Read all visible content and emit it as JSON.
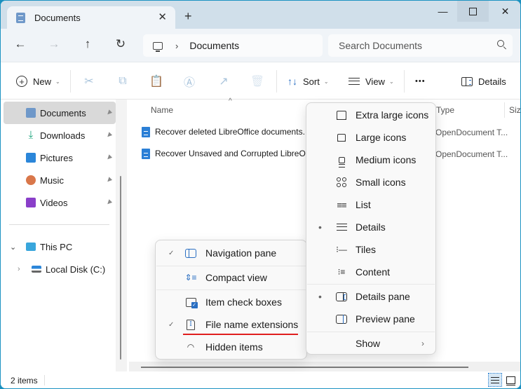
{
  "window": {
    "tab_title": "Documents",
    "tab_icon": "documents-folder-icon",
    "new_tab_glyph": "+",
    "close_tab_glyph": "✕",
    "controls": {
      "minimize": "—",
      "maximize": "maximize-icon",
      "close": "✕"
    }
  },
  "navbar": {
    "back": "←",
    "forward": "→",
    "up": "↑",
    "refresh": "↻",
    "breadcrumb_sep": "›",
    "breadcrumb": [
      "Documents"
    ],
    "search_placeholder": "Search Documents"
  },
  "commandbar": {
    "new_label": "New",
    "new_plus": "+",
    "sort_label": "Sort",
    "view_label": "View",
    "more_glyph": "•••",
    "details_label": "Details",
    "chevron": "⌄",
    "cut": "✂",
    "copy": "⧉",
    "paste": "📋",
    "rename": "Ⓐ",
    "share": "↗",
    "delete": "🗑",
    "sort_glyph": "↑↓"
  },
  "sidebar": {
    "quick_access": [
      {
        "label": "Documents",
        "icon": "documents-icon",
        "color": "#6f98c9",
        "pinned": true,
        "selected": true
      },
      {
        "label": "Downloads",
        "icon": "downloads-icon",
        "color": "#1aa37a",
        "pinned": true,
        "selected": false
      },
      {
        "label": "Pictures",
        "icon": "pictures-icon",
        "color": "#2b86d9",
        "pinned": true,
        "selected": false
      },
      {
        "label": "Music",
        "icon": "music-icon",
        "color": "#d9774a",
        "pinned": true,
        "selected": false
      },
      {
        "label": "Videos",
        "icon": "videos-icon",
        "color": "#8a3fc9",
        "pinned": true,
        "selected": false
      }
    ],
    "pin_glyph": "📌",
    "this_pc": {
      "label": "This PC",
      "chevron": "⌄"
    },
    "local_disk": {
      "label": "Local Disk (C:)",
      "chevron": "›"
    }
  },
  "content": {
    "columns": {
      "name": "Name",
      "type": "Type",
      "size": "Size"
    },
    "sort_arrow": "^",
    "files": [
      {
        "name": "Recover deleted LibreOffice documents.",
        "type": "OpenDocument T..."
      },
      {
        "name": "Recover Unsaved and Corrupted LibreOf",
        "type": "OpenDocument T..."
      }
    ]
  },
  "view_menu": {
    "items": [
      {
        "label": "Extra large icons",
        "icon": "extra-large-icons-icon",
        "selected": false
      },
      {
        "label": "Large icons",
        "icon": "large-icons-icon",
        "selected": false
      },
      {
        "label": "Medium icons",
        "icon": "medium-icons-icon",
        "selected": false
      },
      {
        "label": "Small icons",
        "icon": "small-icons-icon",
        "selected": false
      },
      {
        "label": "List",
        "icon": "list-icon",
        "selected": false
      },
      {
        "label": "Details",
        "icon": "details-icon",
        "selected": true
      },
      {
        "label": "Tiles",
        "icon": "tiles-icon",
        "selected": false
      },
      {
        "label": "Content",
        "icon": "content-icon",
        "selected": false
      }
    ],
    "panes": [
      {
        "label": "Details pane",
        "icon": "details-pane-icon",
        "selected": true
      },
      {
        "label": "Preview pane",
        "icon": "preview-pane-icon",
        "selected": false
      }
    ],
    "show_label": "Show",
    "show_chevron": "›",
    "bullet": "•"
  },
  "show_menu": {
    "items": [
      {
        "label": "Navigation pane",
        "icon": "navigation-pane-icon",
        "checked": true
      },
      {
        "label": "Compact view",
        "icon": "compact-view-icon",
        "checked": false
      },
      {
        "label": "Item check boxes",
        "icon": "item-check-boxes-icon",
        "checked": false
      },
      {
        "label": "File name extensions",
        "icon": "file-name-extensions-icon",
        "checked": true
      },
      {
        "label": "Hidden items",
        "icon": "hidden-items-icon",
        "checked": false
      }
    ],
    "check_glyph": "✓",
    "highlight_color": "#e01e1e"
  },
  "statusbar": {
    "item_count": "2 items"
  },
  "colors": {
    "accent": "#2a6fc2",
    "titlebar": "#d0dfea",
    "navbar": "#f0f4f8",
    "window_border": "#1c93c2"
  }
}
